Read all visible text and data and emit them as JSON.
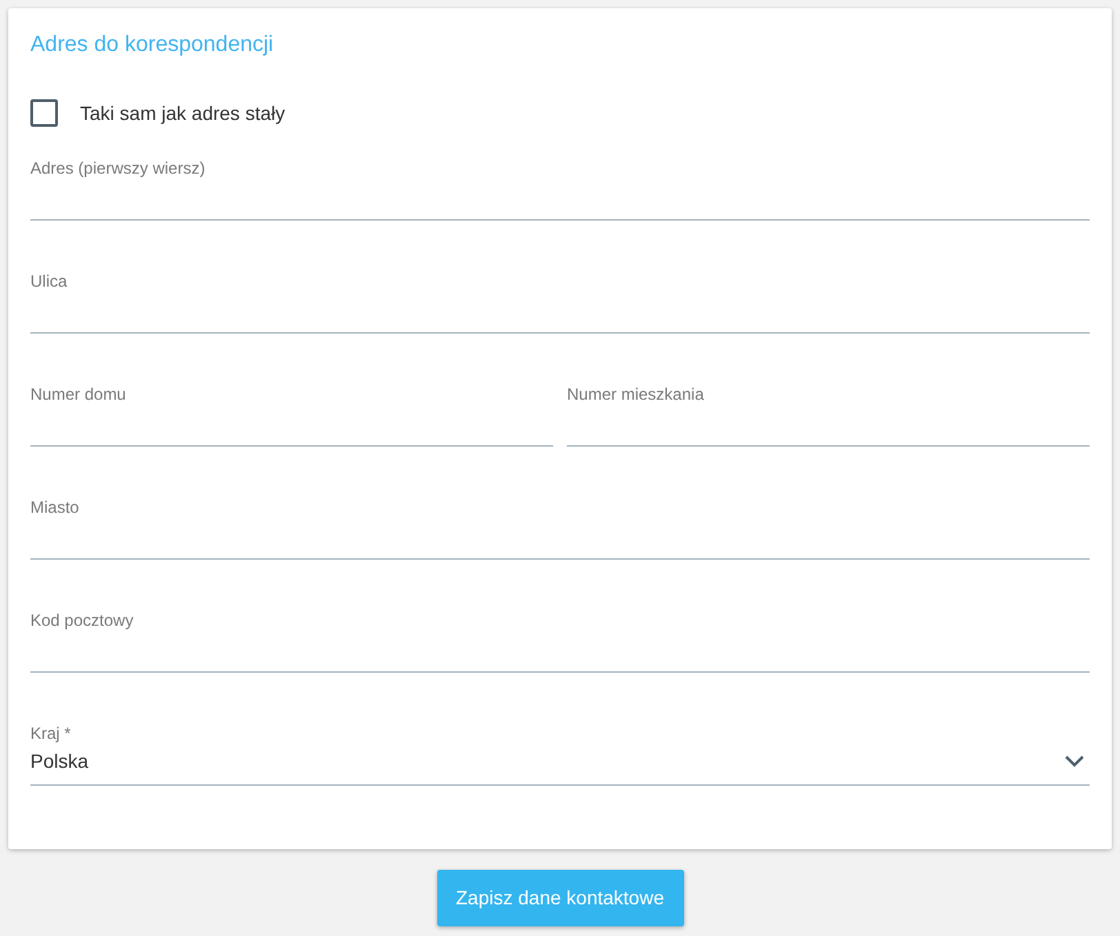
{
  "section_title": "Adres do korespondencji",
  "same_as_permanent": {
    "label": "Taki sam jak adres stały",
    "checked": false
  },
  "field_rows": [
    [
      {
        "kind": "text",
        "label": "Adres (pierwszy wiersz)"
      }
    ],
    [
      {
        "kind": "text",
        "label": "Ulica"
      }
    ],
    [
      {
        "kind": "text",
        "label": "Numer domu"
      },
      {
        "kind": "text",
        "label": "Numer mieszkania"
      }
    ],
    [
      {
        "kind": "text",
        "label": "Miasto"
      }
    ],
    [
      {
        "kind": "text",
        "label": "Kod pocztowy"
      }
    ],
    [
      {
        "kind": "select",
        "label": "Kraj *",
        "value": "Polska"
      }
    ]
  ],
  "save_button": "Zapisz dane kontaktowe"
}
